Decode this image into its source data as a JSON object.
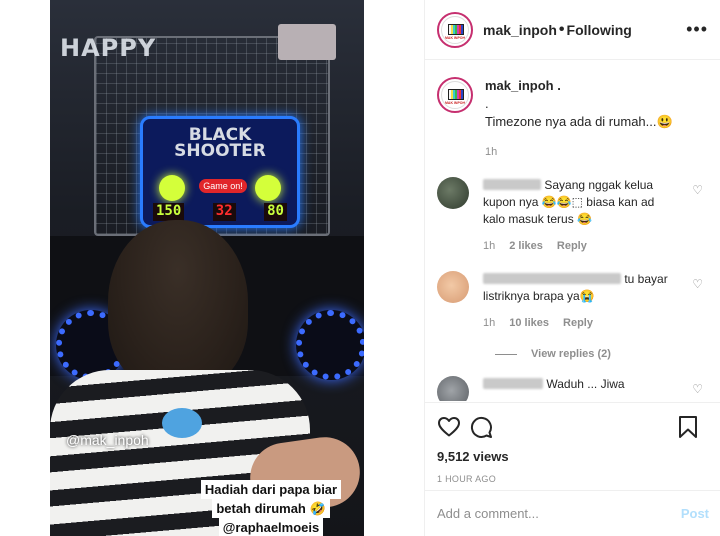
{
  "post": {
    "username": "mak_inpoh",
    "follow_label": "Following",
    "separator": "•",
    "more_icon": "more-horizontal-icon"
  },
  "video": {
    "sign_text": "HAPPY",
    "scoreboard_title": "BLACK SHOOTER",
    "score_pill": "Game on!",
    "digits_left": "150",
    "digits_mid": "32",
    "digits_right": "80",
    "watermark": "@mak_inpoh",
    "caption_line1": "Hadiah dari papa biar",
    "caption_line2": "betah dirumah 🤣",
    "caption_line3": "@raphaelmoeis"
  },
  "caption": {
    "username": "mak_inpoh .",
    "line1": ".",
    "line2": "Timezone nya ada di rumah...😃",
    "time": "1h"
  },
  "comments": [
    {
      "text_line1": "Sayang nggak kelua",
      "text_line2": "kupon nya 😂😂⬚ biasa kan ad",
      "text_line3": "kalo masuk terus 😂",
      "time": "1h",
      "likes": "2 likes",
      "reply": "Reply"
    },
    {
      "text_line1": "tu bayar",
      "text_line2": "listriknya brapa ya😭",
      "time": "1h",
      "likes": "10 likes",
      "reply": "Reply",
      "view_replies": "View replies (2)"
    },
    {
      "text_line1": "Waduh ... Jiwa"
    }
  ],
  "actions": {
    "views": "9,512 views",
    "ago": "1 HOUR AGO",
    "comment_placeholder": "Add a comment...",
    "post_label": "Post"
  }
}
